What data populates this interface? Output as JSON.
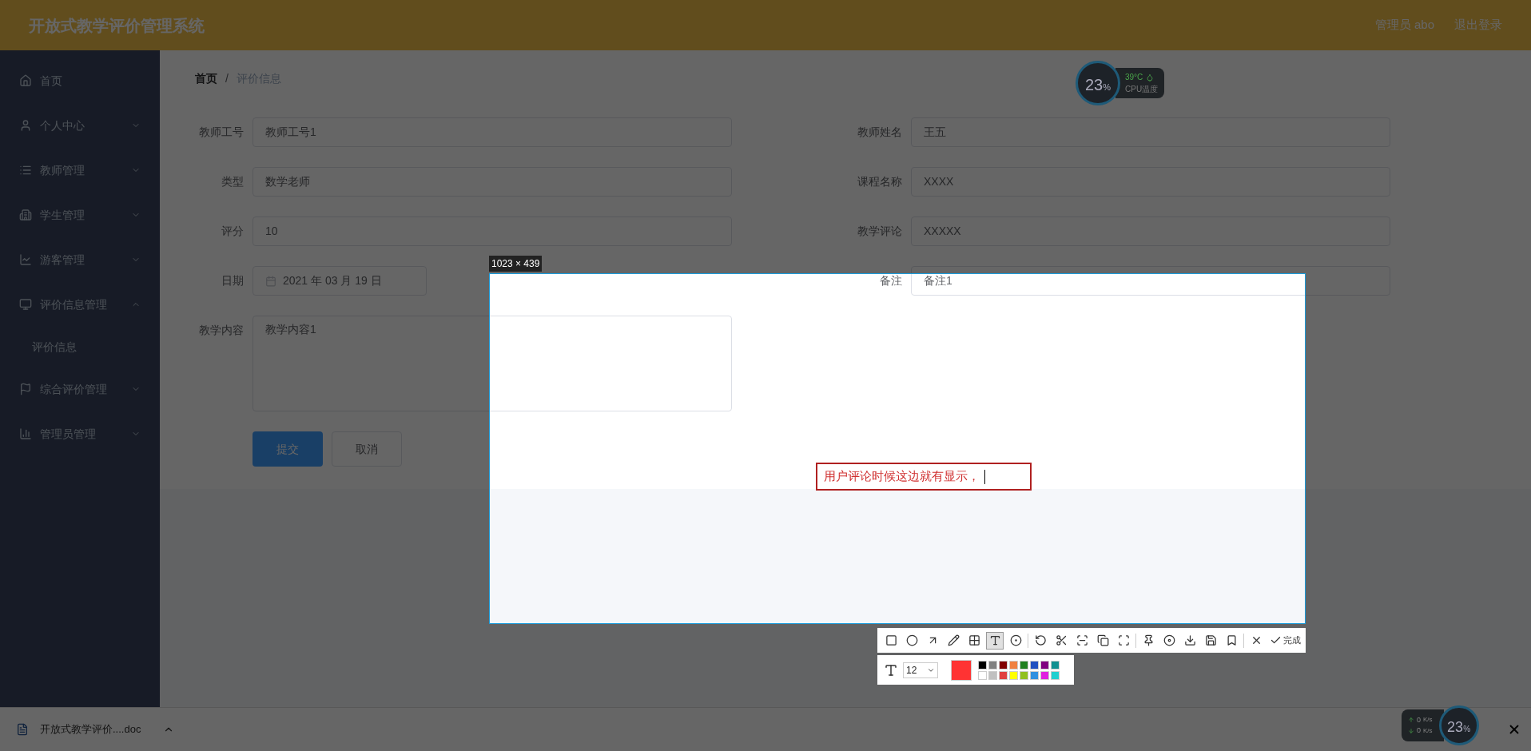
{
  "header": {
    "title": "开放式教学评价管理系统",
    "user": "管理员 abo",
    "logout": "退出登录"
  },
  "sidebar": {
    "items": [
      {
        "label": "首页",
        "kind": "link"
      },
      {
        "label": "个人中心",
        "kind": "group",
        "expanded": false
      },
      {
        "label": "教师管理",
        "kind": "group",
        "expanded": false
      },
      {
        "label": "学生管理",
        "kind": "group",
        "expanded": false
      },
      {
        "label": "游客管理",
        "kind": "group",
        "expanded": false
      },
      {
        "label": "评价信息管理",
        "kind": "group",
        "expanded": true,
        "children": [
          {
            "label": "评价信息"
          }
        ]
      },
      {
        "label": "综合评价管理",
        "kind": "group",
        "expanded": false
      },
      {
        "label": "管理员管理",
        "kind": "group",
        "expanded": false
      }
    ]
  },
  "breadcrumb": {
    "items": [
      "首页",
      "评价信息"
    ],
    "separator": "/"
  },
  "form": {
    "rows": [
      [
        {
          "label": "教师工号",
          "value": "教师工号1",
          "kind": "text"
        },
        {
          "label": "教师姓名",
          "value": "王五",
          "kind": "text"
        }
      ],
      [
        {
          "label": "类型",
          "value": "数学老师",
          "kind": "text"
        },
        {
          "label": "课程名称",
          "value": "XXXX",
          "kind": "text"
        }
      ],
      [
        {
          "label": "评分",
          "value": "10",
          "kind": "text"
        },
        {
          "label": "教学评论",
          "value": "XXXXX",
          "kind": "text"
        }
      ],
      [
        {
          "label": "日期",
          "value": "2021 年 03 月 19 日",
          "kind": "date"
        },
        {
          "label": "备注",
          "value": "备注1",
          "kind": "text"
        }
      ],
      [
        {
          "label": "教学内容",
          "value": "教学内容1",
          "kind": "textarea"
        }
      ]
    ],
    "buttons": [
      {
        "label": "提交",
        "kind": "primary"
      },
      {
        "label": "取消",
        "kind": "default"
      }
    ]
  },
  "cpu_widget": {
    "percent": "23",
    "unit": "%",
    "temperature": "39°C",
    "caption": "CPU温度"
  },
  "capture": {
    "size": "1023 × 439",
    "annotation": "用户评论时候这边就有显示，",
    "tools": [
      {
        "kind": "rect",
        "selected": false
      },
      {
        "kind": "circle",
        "selected": false
      },
      {
        "kind": "arrow",
        "selected": false
      },
      {
        "kind": "pencil",
        "selected": false
      },
      {
        "kind": "mosaic",
        "selected": false
      },
      {
        "kind": "text",
        "selected": true
      },
      {
        "kind": "number",
        "selected": false
      },
      {
        "kind": "sep"
      },
      {
        "kind": "undo",
        "selected": false
      },
      {
        "kind": "cut",
        "selected": false
      },
      {
        "kind": "scan",
        "selected": false
      },
      {
        "kind": "copy",
        "selected": false
      },
      {
        "kind": "expand",
        "selected": false
      },
      {
        "kind": "sep"
      },
      {
        "kind": "pin",
        "selected": false
      },
      {
        "kind": "record",
        "selected": false
      },
      {
        "kind": "download",
        "selected": false
      },
      {
        "kind": "save",
        "selected": false
      },
      {
        "kind": "bookmark",
        "selected": false
      },
      {
        "kind": "sep"
      },
      {
        "kind": "close",
        "selected": false
      }
    ],
    "done": "完成",
    "font_size": "12",
    "palette": [
      {
        "color": "#000000"
      },
      {
        "color": "#808080"
      },
      {
        "color": "#800000"
      },
      {
        "color": "#f08040"
      },
      {
        "color": "#208020"
      },
      {
        "color": "#2050c0"
      },
      {
        "color": "#800080"
      },
      {
        "color": "#109090"
      },
      {
        "color": "#ffffff"
      },
      {
        "color": "#c0c0c0"
      },
      {
        "color": "#e04040"
      },
      {
        "color": "#ffff00"
      },
      {
        "color": "#90c020"
      },
      {
        "color": "#3090e0"
      },
      {
        "color": "#e020e0"
      },
      {
        "color": "#20d0d0"
      }
    ]
  },
  "download_bar": {
    "file": "开放式教学评价....doc"
  },
  "net_widget": {
    "up": "0",
    "down": "0",
    "up_unit": "K/s",
    "down_unit": "K/s",
    "percent": "23",
    "percent_unit": "%"
  }
}
